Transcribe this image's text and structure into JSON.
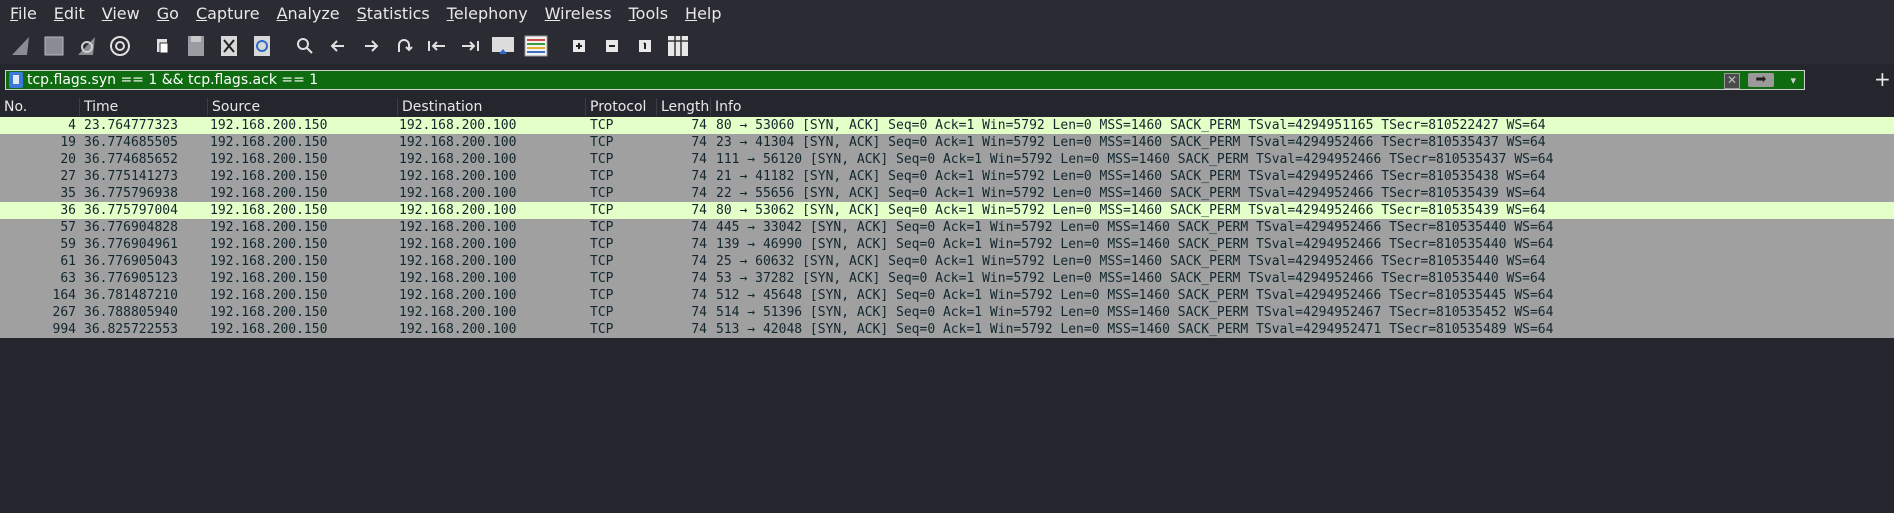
{
  "menu": [
    "File",
    "Edit",
    "View",
    "Go",
    "Capture",
    "Analyze",
    "Statistics",
    "Telephony",
    "Wireless",
    "Tools",
    "Help"
  ],
  "toolbar": {
    "icons": [
      "start-capture-icon",
      "stop-capture-icon",
      "restart-capture-icon",
      "capture-options-icon",
      "open-file-icon",
      "save-file-icon",
      "close-file-icon",
      "reload-file-icon",
      "find-packet-icon",
      "go-back-icon",
      "go-forward-icon",
      "go-to-packet-icon",
      "first-packet-icon",
      "last-packet-icon",
      "auto-scroll-icon",
      "colorize-icon",
      "zoom-in-icon",
      "zoom-out-icon",
      "normal-size-icon",
      "resize-columns-icon"
    ]
  },
  "filter": {
    "value": "tcp.flags.syn == 1 && tcp.flags.ack == 1"
  },
  "columns": [
    "No.",
    "Time",
    "Source",
    "Destination",
    "Protocol",
    "Length",
    "Info"
  ],
  "packets": [
    {
      "no": "4",
      "time": "23.764777323",
      "src": "192.168.200.150",
      "dst": "192.168.200.100",
      "proto": "TCP",
      "len": "74",
      "info": "80 → 53060 [SYN, ACK] Seq=0 Ack=1 Win=5792 Len=0 MSS=1460 SACK_PERM TSval=4294951165 TSecr=810522427 WS=64",
      "highlight": true
    },
    {
      "no": "19",
      "time": "36.774685505",
      "src": "192.168.200.150",
      "dst": "192.168.200.100",
      "proto": "TCP",
      "len": "74",
      "info": "23 → 41304 [SYN, ACK] Seq=0 Ack=1 Win=5792 Len=0 MSS=1460 SACK_PERM TSval=4294952466 TSecr=810535437 WS=64",
      "highlight": false
    },
    {
      "no": "20",
      "time": "36.774685652",
      "src": "192.168.200.150",
      "dst": "192.168.200.100",
      "proto": "TCP",
      "len": "74",
      "info": "111 → 56120 [SYN, ACK] Seq=0 Ack=1 Win=5792 Len=0 MSS=1460 SACK_PERM TSval=4294952466 TSecr=810535437 WS=64",
      "highlight": false
    },
    {
      "no": "27",
      "time": "36.775141273",
      "src": "192.168.200.150",
      "dst": "192.168.200.100",
      "proto": "TCP",
      "len": "74",
      "info": "21 → 41182 [SYN, ACK] Seq=0 Ack=1 Win=5792 Len=0 MSS=1460 SACK_PERM TSval=4294952466 TSecr=810535438 WS=64",
      "highlight": false
    },
    {
      "no": "35",
      "time": "36.775796938",
      "src": "192.168.200.150",
      "dst": "192.168.200.100",
      "proto": "TCP",
      "len": "74",
      "info": "22 → 55656 [SYN, ACK] Seq=0 Ack=1 Win=5792 Len=0 MSS=1460 SACK_PERM TSval=4294952466 TSecr=810535439 WS=64",
      "highlight": false
    },
    {
      "no": "36",
      "time": "36.775797004",
      "src": "192.168.200.150",
      "dst": "192.168.200.100",
      "proto": "TCP",
      "len": "74",
      "info": "80 → 53062 [SYN, ACK] Seq=0 Ack=1 Win=5792 Len=0 MSS=1460 SACK_PERM TSval=4294952466 TSecr=810535439 WS=64",
      "highlight": true
    },
    {
      "no": "57",
      "time": "36.776904828",
      "src": "192.168.200.150",
      "dst": "192.168.200.100",
      "proto": "TCP",
      "len": "74",
      "info": "445 → 33042 [SYN, ACK] Seq=0 Ack=1 Win=5792 Len=0 MSS=1460 SACK_PERM TSval=4294952466 TSecr=810535440 WS=64",
      "highlight": false
    },
    {
      "no": "59",
      "time": "36.776904961",
      "src": "192.168.200.150",
      "dst": "192.168.200.100",
      "proto": "TCP",
      "len": "74",
      "info": "139 → 46990 [SYN, ACK] Seq=0 Ack=1 Win=5792 Len=0 MSS=1460 SACK_PERM TSval=4294952466 TSecr=810535440 WS=64",
      "highlight": false
    },
    {
      "no": "61",
      "time": "36.776905043",
      "src": "192.168.200.150",
      "dst": "192.168.200.100",
      "proto": "TCP",
      "len": "74",
      "info": "25 → 60632 [SYN, ACK] Seq=0 Ack=1 Win=5792 Len=0 MSS=1460 SACK_PERM TSval=4294952466 TSecr=810535440 WS=64",
      "highlight": false
    },
    {
      "no": "63",
      "time": "36.776905123",
      "src": "192.168.200.150",
      "dst": "192.168.200.100",
      "proto": "TCP",
      "len": "74",
      "info": "53 → 37282 [SYN, ACK] Seq=0 Ack=1 Win=5792 Len=0 MSS=1460 SACK_PERM TSval=4294952466 TSecr=810535440 WS=64",
      "highlight": false
    },
    {
      "no": "164",
      "time": "36.781487210",
      "src": "192.168.200.150",
      "dst": "192.168.200.100",
      "proto": "TCP",
      "len": "74",
      "info": "512 → 45648 [SYN, ACK] Seq=0 Ack=1 Win=5792 Len=0 MSS=1460 SACK_PERM TSval=4294952466 TSecr=810535445 WS=64",
      "highlight": false
    },
    {
      "no": "267",
      "time": "36.788805940",
      "src": "192.168.200.150",
      "dst": "192.168.200.100",
      "proto": "TCP",
      "len": "74",
      "info": "514 → 51396 [SYN, ACK] Seq=0 Ack=1 Win=5792 Len=0 MSS=1460 SACK_PERM TSval=4294952467 TSecr=810535452 WS=64",
      "highlight": false
    },
    {
      "no": "994",
      "time": "36.825722553",
      "src": "192.168.200.150",
      "dst": "192.168.200.100",
      "proto": "TCP",
      "len": "74",
      "info": "513 → 42048 [SYN, ACK] Seq=0 Ack=1 Win=5792 Len=0 MSS=1460 SACK_PERM TSval=4294952471 TSecr=810535489 WS=64",
      "highlight": false
    }
  ]
}
